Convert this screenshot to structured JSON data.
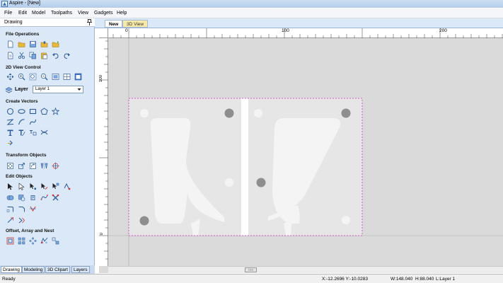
{
  "window": {
    "title": "Aspire - [New]"
  },
  "menu": [
    "File",
    "Edit",
    "Model",
    "Toolpaths",
    "View",
    "Gadgets",
    "Help"
  ],
  "panel": {
    "title": "Drawing",
    "sections": {
      "file_operations": "File Operations",
      "view_control": "2D View Control",
      "create_vectors": "Create Vectors",
      "transform_objects": "Transform Objects",
      "edit_objects": "Edit Objects",
      "offset_array_nest": "Offset, Array and Nest"
    },
    "layer_label": "Layer",
    "layer_value": "Layer 1"
  },
  "bottom_tabs": [
    "Drawing",
    "Modeling",
    "3D Clipart",
    "Layers"
  ],
  "doc_tabs": [
    "New",
    "3D View"
  ],
  "rulers": {
    "h_labels": [
      "0",
      "100",
      "200"
    ],
    "v_labels": [
      "100",
      "0"
    ]
  },
  "status": {
    "ready": "Ready",
    "coords": "X:-12.2696 Y:-10.0283",
    "width": "W:148.040",
    "height": "H:88.040",
    "layer": "L:Layer 1"
  },
  "colors": {
    "accent": "#3a6fb6",
    "selection": "#cc33cc",
    "workspace": "#dadada"
  },
  "icons": {
    "file_operations": [
      "new-file-icon",
      "open-file-icon",
      "save-icon",
      "open-folder-icon",
      "import-icon",
      "copy-page-icon",
      "cut-icon",
      "copy-icon",
      "paste-icon",
      "undo-icon",
      "redo-icon"
    ],
    "view_control": [
      "pan-icon",
      "zoom-in-icon",
      "zoom-box-icon",
      "zoom-out-icon",
      "zoom-extents-icon",
      "zoom-material-icon",
      "window-icon"
    ],
    "create_vectors": [
      "circle-icon",
      "ellipse-icon",
      "rectangle-icon",
      "polygon-icon",
      "star-icon",
      "polyline-icon",
      "arc-icon",
      "curve-icon",
      "text-icon",
      "text-on-curve-icon",
      "auto-layout-icon",
      "trace-icon",
      "dimension-icon"
    ],
    "transform_objects": [
      "move-icon",
      "scale-icon",
      "rotate-icon",
      "mirror-icon",
      "align-icon"
    ],
    "edit_objects": [
      "select-icon",
      "node-edit-icon",
      "node-tool-icon",
      "interactive-trim-icon",
      "transform-icon",
      "smart-snap-icon",
      "weld-icon",
      "subtract-icon",
      "join-icon",
      "curve-fit-icon",
      "scissors-icon",
      "fillet-icon",
      "chamfer-icon",
      "trim-icon",
      "extend-icon",
      "dogbone-icon"
    ],
    "offset_array_nest": [
      "offset-icon",
      "array-icon",
      "circular-array-icon",
      "nest-icon",
      "step-repeat-icon"
    ]
  }
}
